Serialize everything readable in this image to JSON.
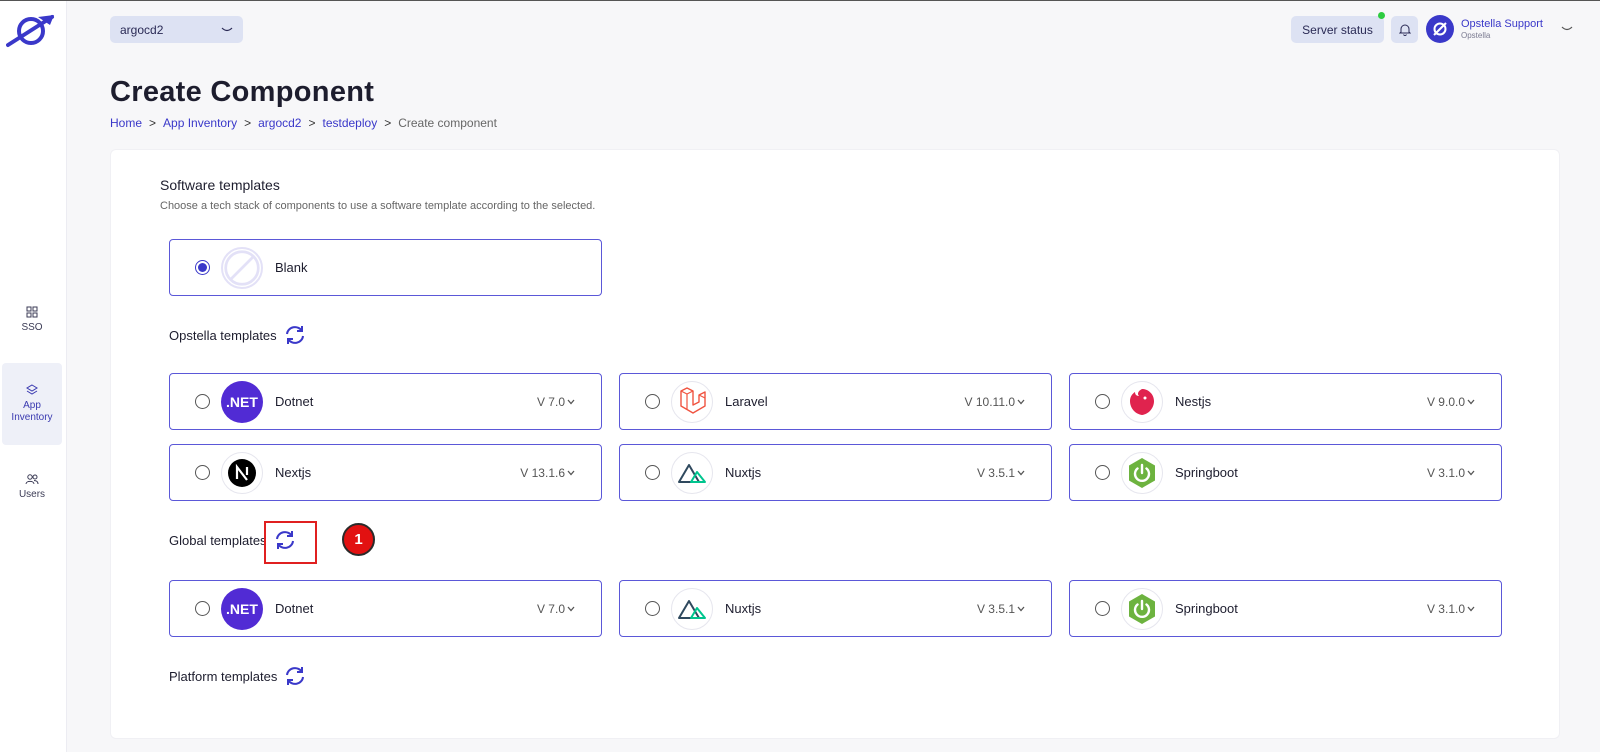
{
  "app": {
    "workspace": "argocd2",
    "server_status_label": "Server status",
    "user": {
      "name": "Opstella Support",
      "org": "Opstella"
    }
  },
  "sidebar": {
    "items": [
      {
        "label": "SSO",
        "icon": "grid-icon",
        "active": false
      },
      {
        "label": "App Inventory",
        "icon": "layers-icon",
        "active": true
      },
      {
        "label": "Users",
        "icon": "users-icon",
        "active": false
      }
    ]
  },
  "page": {
    "title": "Create Component",
    "breadcrumb": [
      "Home",
      "App Inventory",
      "argocd2",
      "testdeploy",
      "Create component"
    ]
  },
  "software_templates": {
    "title": "Software templates",
    "description": "Choose a tech stack of components to use a software template according to the selected.",
    "blank": {
      "name": "Blank",
      "selected": true
    },
    "opstella_title": "Opstella templates",
    "opstella": [
      {
        "name": "Dotnet",
        "version": "V 7.0",
        "logo": "dotnet-logo"
      },
      {
        "name": "Laravel",
        "version": "V 10.11.0",
        "logo": "laravel-logo"
      },
      {
        "name": "Nestjs",
        "version": "V 9.0.0",
        "logo": "nestjs-logo"
      },
      {
        "name": "Nextjs",
        "version": "V 13.1.6",
        "logo": "nextjs-logo"
      },
      {
        "name": "Nuxtjs",
        "version": "V 3.5.1",
        "logo": "nuxtjs-logo"
      },
      {
        "name": "Springboot",
        "version": "V 3.1.0",
        "logo": "springboot-logo"
      }
    ],
    "global_title": "Global templates",
    "global": [
      {
        "name": "Dotnet",
        "version": "V 7.0",
        "logo": "dotnet-logo"
      },
      {
        "name": "Nuxtjs",
        "version": "V 3.5.1",
        "logo": "nuxtjs-logo"
      },
      {
        "name": "Springboot",
        "version": "V 3.1.0",
        "logo": "springboot-logo"
      }
    ],
    "platform_title": "Platform templates"
  },
  "annotation": {
    "marker": "1"
  },
  "colors": {
    "accent": "#3a38c9",
    "tile_border": "#5b58d8",
    "highlight": "#e02020",
    "status_ok": "#2ecc40"
  }
}
